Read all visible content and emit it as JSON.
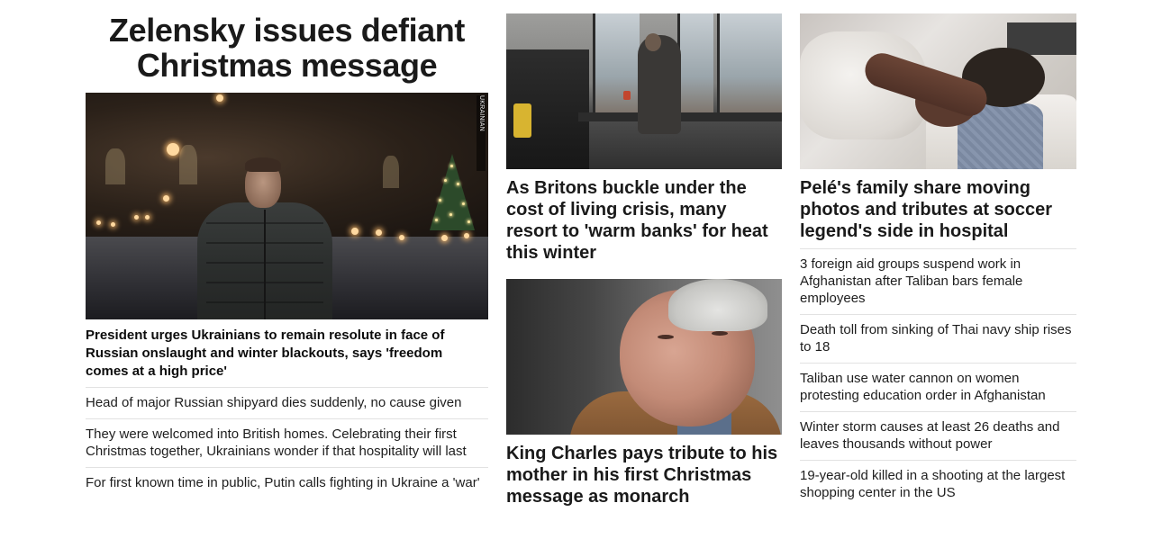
{
  "lead": {
    "title": "Zelensky issues defiant Christmas message",
    "photo_credit": "UKRAINIAN PRESIDENCY",
    "description": "President urges Ukrainians to remain resolute in face of Russian onslaught and winter blackouts, says 'freedom comes at a high price'",
    "links": [
      "Head of major Russian shipyard dies suddenly, no cause given",
      "They were welcomed into British homes. Celebrating their first Christmas together, Ukrainians wonder if that hospitality will last",
      "For first known time in public, Putin calls fighting in Ukraine a 'war'"
    ]
  },
  "middle": {
    "story1": {
      "headline": "As Britons buckle under the cost of living crisis, many resort to 'warm banks' for heat this winter"
    },
    "story2": {
      "headline": "King Charles pays tribute to his mother in his first Christmas message as monarch"
    }
  },
  "right": {
    "headline": "Pelé's family share moving photos and tributes at soccer legend's side in hospital",
    "links": [
      "3 foreign aid groups suspend work in Afghanistan after Taliban bars female employees",
      "Death toll from sinking of Thai navy ship rises to 18",
      "Taliban use water cannon on women protesting education order in Afghanistan",
      "Winter storm causes at least 26 deaths and leaves thousands without power",
      "19-year-old killed in a shooting at the largest shopping center in the US"
    ]
  }
}
